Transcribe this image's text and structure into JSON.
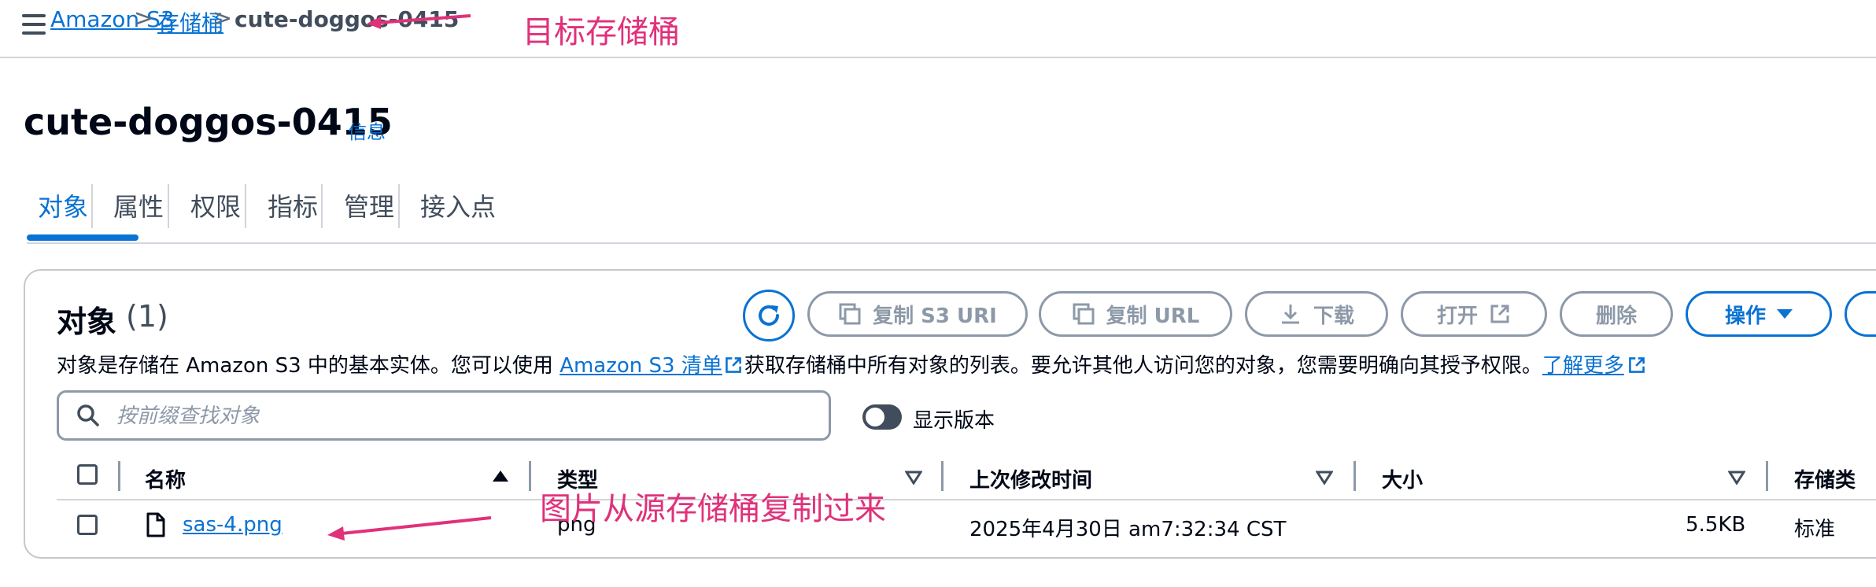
{
  "breadcrumb": {
    "items": [
      "Amazon S3",
      "存储桶"
    ],
    "current": "cute-doggos-0415",
    "separator": ">"
  },
  "annotations": {
    "target_bucket": "目标存储桶",
    "copied_from_source": "图片从源存储桶复制过来"
  },
  "page": {
    "title": "cute-doggos-0415",
    "info_link": "信息"
  },
  "tabs": [
    {
      "label": "对象",
      "active": true
    },
    {
      "label": "属性",
      "active": false
    },
    {
      "label": "权限",
      "active": false
    },
    {
      "label": "指标",
      "active": false
    },
    {
      "label": "管理",
      "active": false
    },
    {
      "label": "接入点",
      "active": false
    }
  ],
  "objects": {
    "heading": "对象",
    "count": "(1)",
    "description_before": "对象是存储在 Amazon S3 中的基本实体。您可以使用 ",
    "inventory_link": "Amazon S3 清单",
    "description_middle": "获取存储桶中所有对象的列表。要允许其他人访问您的对象，您需要明确向其授予权限。",
    "learn_more": "了解更多",
    "search_placeholder": "按前缀查找对象",
    "show_versions_label": "显示版本",
    "show_versions_on": false
  },
  "toolbar": {
    "copy_s3_uri": "复制 S3 URI",
    "copy_url": "复制 URL",
    "download": "下载",
    "open": "打开",
    "delete": "删除",
    "actions": "操作"
  },
  "table": {
    "columns": [
      "名称",
      "类型",
      "上次修改时间",
      "大小",
      "存储类"
    ],
    "rows": [
      {
        "name": "sas-4.png",
        "type": "png",
        "last_modified": "2025年4月30日 am7:32:34 CST",
        "size": "5.5KB",
        "storage_class": "标准"
      }
    ]
  },
  "colors": {
    "link_blue": "#0972d3",
    "annotation_pink": "#e0317a",
    "disabled_gray": "#8d99a8"
  },
  "icons": [
    "menu-icon",
    "chevron-right-icon",
    "refresh-icon",
    "copy-icon",
    "download-icon",
    "external-link-icon",
    "caret-down-icon",
    "search-icon",
    "file-icon",
    "sort-ascending-icon",
    "filter-caret-icon"
  ]
}
